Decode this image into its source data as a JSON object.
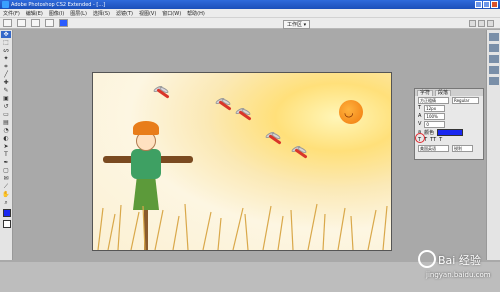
{
  "window": {
    "title": "Adobe Photoshop CS2 Extended - [...]"
  },
  "menu": [
    "文件(F)",
    "编辑(E)",
    "图像(I)",
    "图层(L)",
    "选择(S)",
    "滤镜(T)",
    "视图(V)",
    "窗口(W)",
    "帮助(H)"
  ],
  "options": {
    "workspace": "工作区 ▾"
  },
  "panel": {
    "tabs": [
      "字符",
      "段落"
    ],
    "font": "方正粗倩",
    "style": "Regular",
    "size": "12px",
    "leading": "100%",
    "tracking": "0",
    "color_label": "颜色",
    "color": "#1a28f0",
    "language": "美国英语",
    "aa": "锐利"
  },
  "watermark": {
    "brand": "Bai 经验",
    "url": "jingyan.baidu.com"
  }
}
